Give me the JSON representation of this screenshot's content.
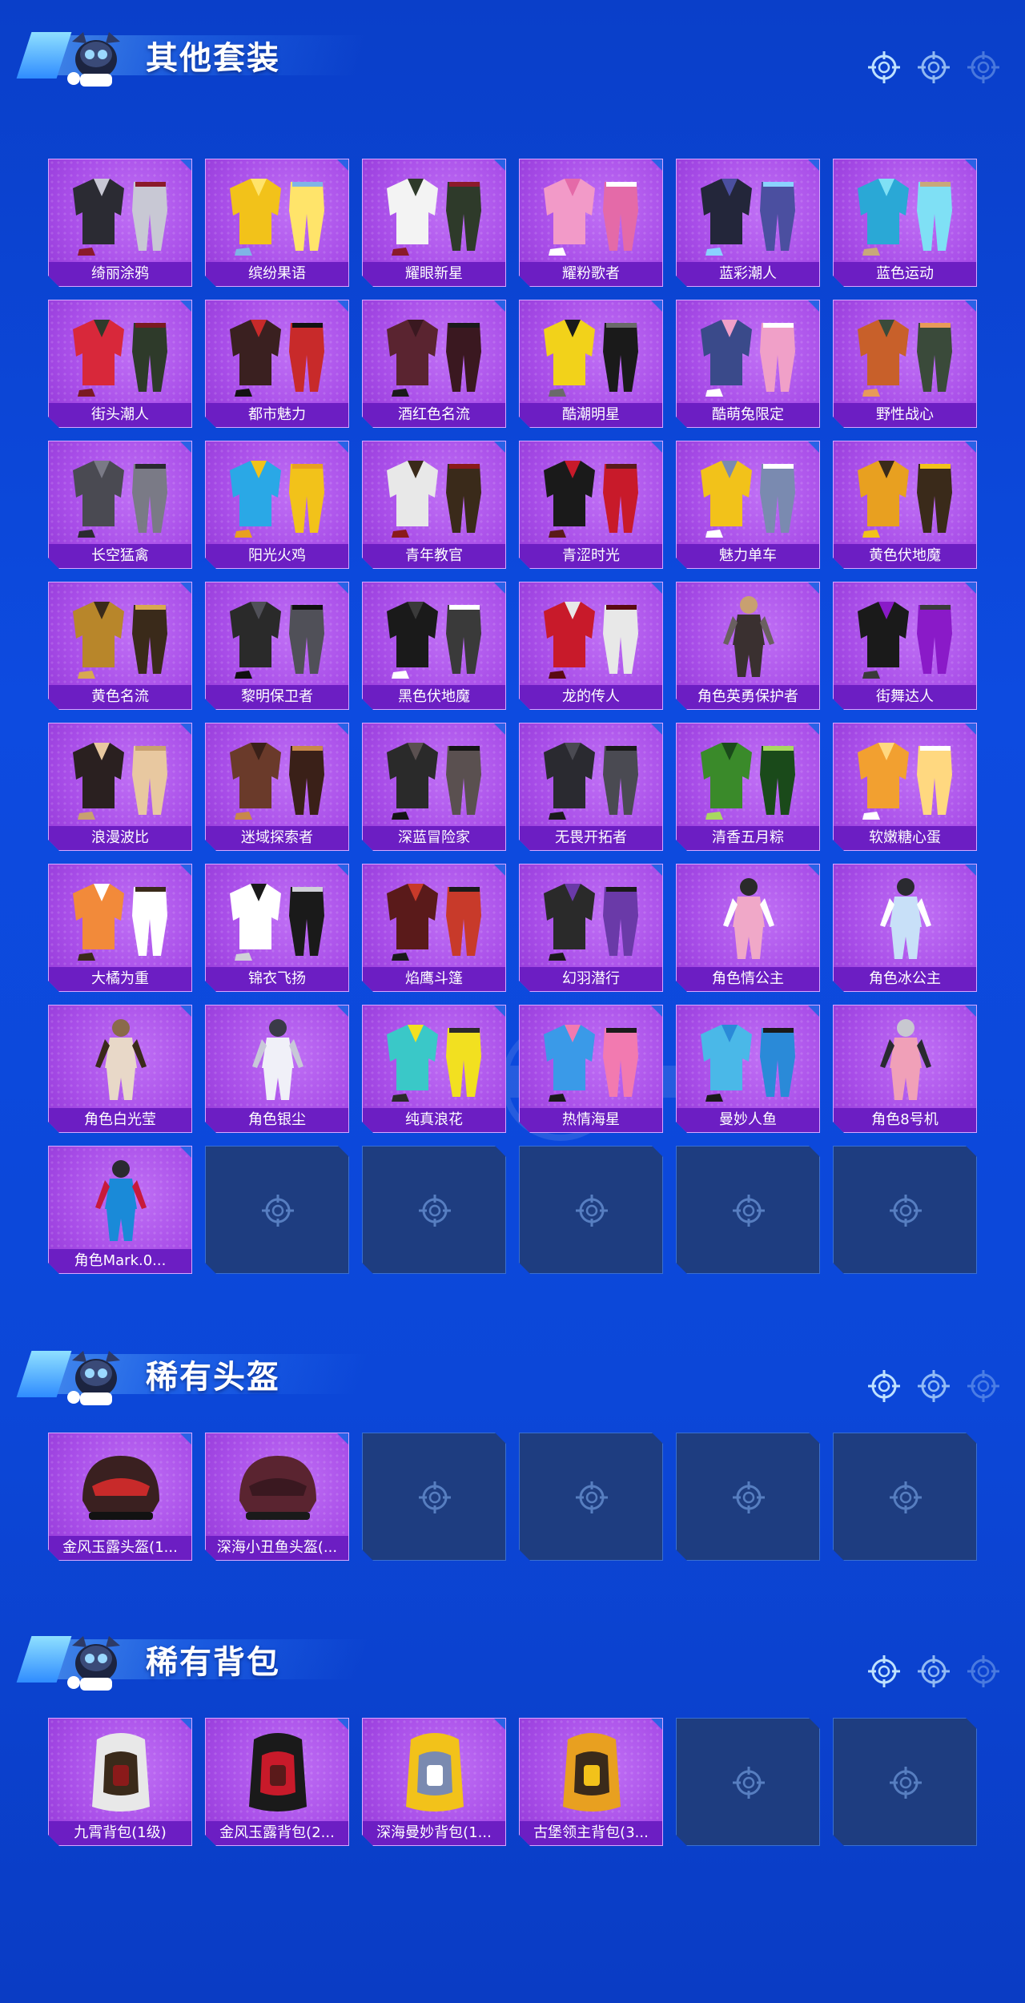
{
  "colors": {
    "background": "#0c47d8",
    "card": "#a84de8",
    "card_label_bg": "#6c1ec3",
    "empty_slot": "#1e3d80",
    "text": "#ffffff"
  },
  "sections": [
    {
      "title": "其他套装",
      "items": [
        {
          "name": "绮丽涂鸦",
          "icon": "outfit-icon"
        },
        {
          "name": "缤纷果语",
          "icon": "outfit-icon"
        },
        {
          "name": "耀眼新星",
          "icon": "outfit-icon"
        },
        {
          "name": "耀粉歌者",
          "icon": "outfit-icon"
        },
        {
          "name": "蓝彩潮人",
          "icon": "outfit-icon"
        },
        {
          "name": "蓝色运动",
          "icon": "outfit-icon"
        },
        {
          "name": "街头潮人",
          "icon": "outfit-icon"
        },
        {
          "name": "都市魅力",
          "icon": "outfit-icon"
        },
        {
          "name": "酒红色名流",
          "icon": "outfit-icon"
        },
        {
          "name": "酷潮明星",
          "icon": "outfit-icon"
        },
        {
          "name": "酷萌兔限定",
          "icon": "outfit-icon"
        },
        {
          "name": "野性战心",
          "icon": "outfit-icon"
        },
        {
          "name": "长空猛禽",
          "icon": "outfit-icon"
        },
        {
          "name": "阳光火鸡",
          "icon": "outfit-icon"
        },
        {
          "name": "青年教官",
          "icon": "outfit-icon"
        },
        {
          "name": "青涩时光",
          "icon": "outfit-icon"
        },
        {
          "name": "魅力单车",
          "icon": "outfit-icon"
        },
        {
          "name": "黄色伏地魔",
          "icon": "outfit-icon"
        },
        {
          "name": "黄色名流",
          "icon": "outfit-icon"
        },
        {
          "name": "黎明保卫者",
          "icon": "outfit-icon"
        },
        {
          "name": "黑色伏地魔",
          "icon": "outfit-icon"
        },
        {
          "name": "龙的传人",
          "icon": "outfit-icon"
        },
        {
          "name": "角色英勇保护者",
          "icon": "character-icon"
        },
        {
          "name": "街舞达人",
          "icon": "outfit-icon"
        },
        {
          "name": "浪漫波比",
          "icon": "outfit-icon"
        },
        {
          "name": "迷域探索者",
          "icon": "outfit-icon"
        },
        {
          "name": "深蓝冒险家",
          "icon": "outfit-icon"
        },
        {
          "name": "无畏开拓者",
          "icon": "outfit-icon"
        },
        {
          "name": "清香五月粽",
          "icon": "outfit-icon"
        },
        {
          "name": "软嫩糖心蛋",
          "icon": "outfit-icon"
        },
        {
          "name": "大橘为重",
          "icon": "outfit-icon"
        },
        {
          "name": "锦衣飞扬",
          "icon": "outfit-icon"
        },
        {
          "name": "焰鹰斗篷",
          "icon": "outfit-icon"
        },
        {
          "name": "幻羽潜行",
          "icon": "outfit-icon"
        },
        {
          "name": "角色情公主",
          "icon": "character-icon"
        },
        {
          "name": "角色冰公主",
          "icon": "character-icon"
        },
        {
          "name": "角色白光莹",
          "icon": "character-icon"
        },
        {
          "name": "角色银尘",
          "icon": "character-icon"
        },
        {
          "name": "纯真浪花",
          "icon": "outfit-icon"
        },
        {
          "name": "热情海星",
          "icon": "outfit-icon"
        },
        {
          "name": "曼妙人鱼",
          "icon": "outfit-icon"
        },
        {
          "name": "角色8号机",
          "icon": "character-icon"
        },
        {
          "name": "角色Mark.0...",
          "icon": "character-icon"
        }
      ],
      "empty_slots": 5
    },
    {
      "title": "稀有头盔",
      "items": [
        {
          "name": "金风玉露头盔(1...",
          "icon": "helmet-icon"
        },
        {
          "name": "深海小丑鱼头盔(...",
          "icon": "helmet-icon"
        }
      ],
      "empty_slots": 4
    },
    {
      "title": "稀有背包",
      "items": [
        {
          "name": "九霄背包(1级)",
          "icon": "backpack-icon"
        },
        {
          "name": "金风玉露背包(2...",
          "icon": "backpack-icon"
        },
        {
          "name": "深海曼妙背包(1...",
          "icon": "backpack-icon"
        },
        {
          "name": "古堡领主背包(3...",
          "icon": "backpack-icon"
        }
      ],
      "empty_slots": 2
    }
  ]
}
